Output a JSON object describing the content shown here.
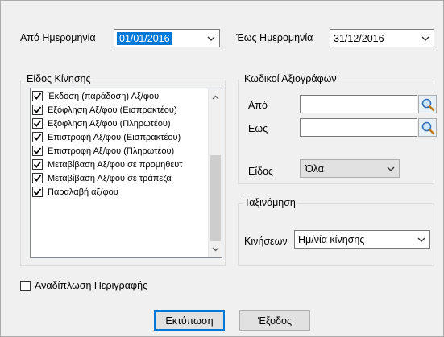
{
  "date_range": {
    "from_label": "Από Ημερομηνία",
    "from_value": "01/01/2016",
    "to_label": "Έως Ημερομηνία",
    "to_value": "31/12/2016"
  },
  "movement_type": {
    "title": "Είδος Κίνησης",
    "items": [
      {
        "label": "Έκδοση (παράδοση) Αξ/φου",
        "checked": true
      },
      {
        "label": "Εξόφληση Αξ/φου (Εισπρακτέου)",
        "checked": true
      },
      {
        "label": "Εξόφληση Αξ/φου (Πληρωτέου)",
        "checked": true
      },
      {
        "label": "Επιστροφή Αξ/φου (Εισπρακτέου)",
        "checked": true
      },
      {
        "label": "Επιστροφή Αξ/φου (Πληρωτέου)",
        "checked": true
      },
      {
        "label": "Μεταβίβαση Αξ/φου σε προμηθευτ",
        "checked": true
      },
      {
        "label": "Μεταβίβαση Αξ/φου σε τράπεζα",
        "checked": true
      },
      {
        "label": "Παραλαβή αξ/φου",
        "checked": true
      }
    ]
  },
  "codes": {
    "title": "Κωδικοί Αξιογράφων",
    "from_label": "Από",
    "from_value": "",
    "to_label": "Εως",
    "to_value": "",
    "kind_label": "Είδος",
    "kind_value": "Όλα"
  },
  "sorting": {
    "title": "Ταξινόμηση",
    "label": "Κινήσεων",
    "value": "Ημ/νία κίνησης"
  },
  "options": {
    "description_wrap_label": "Αναδίπλωση Περιγραφής",
    "description_wrap_checked": false
  },
  "buttons": {
    "print_label": "Εκτύπωση",
    "exit_label": "Έξοδος"
  },
  "icons": {
    "dropdown": "chevron-down-icon",
    "lookup": "magnifier-icon",
    "check": "checkmark-icon"
  }
}
